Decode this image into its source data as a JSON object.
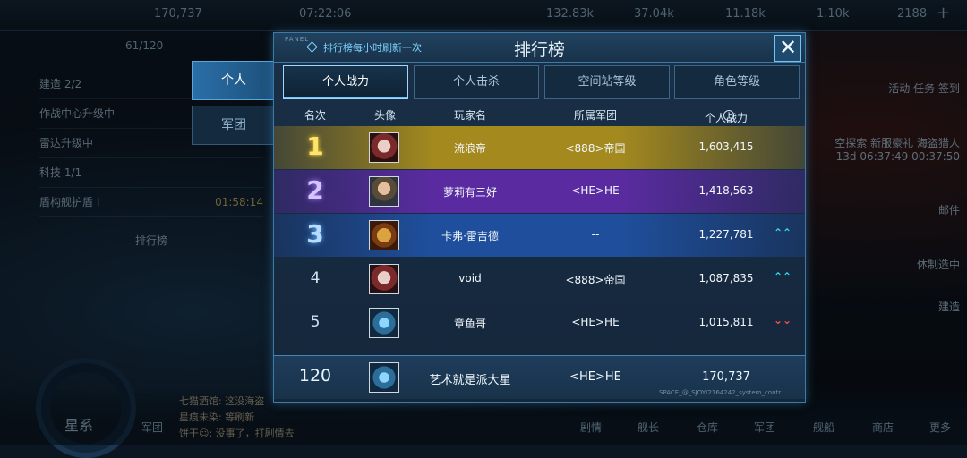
{
  "hud": {
    "top_values": [
      "170,737",
      "07:22:06",
      "132.83k",
      "37.04k",
      "11.18k",
      "1.10k",
      "2188"
    ],
    "level": "61/120",
    "left_rows": [
      "建造 2/2",
      "作战中心升级中",
      "雷达升级中",
      "科技 1/1",
      "盾构舰护盾 I",
      "排行榜"
    ],
    "shield_timer": "01:58:14",
    "right_items": [
      "活动",
      "任务",
      "签到",
      "空探索",
      "新服豪礼",
      "海盗猎人",
      "13d 06:37:49",
      "00:37:50",
      "邮件",
      "体制造中",
      "建造"
    ],
    "galaxy_label": "星系",
    "chat_lines": [
      "七猫酒馆: 这没海盗",
      "星痕未染: 等刷新",
      "饼干☺: 没事了，打剧情去"
    ],
    "nav_items": [
      "军团",
      "剧情",
      "舰长",
      "仓库",
      "军团",
      "舰船",
      "商店",
      "更多"
    ]
  },
  "side_tabs": {
    "personal": "个人",
    "legion": "军团"
  },
  "panel": {
    "tag": "PANEL",
    "title": "排行榜",
    "refresh_note": "排行榜每小时刷新一次",
    "close_symbol": "✕",
    "tabs": [
      "个人战力",
      "个人击杀",
      "空间站等级",
      "角色等级"
    ],
    "active_tab": "个人战力",
    "columns": [
      "名次",
      "头像",
      "玩家名",
      "所属军团",
      "个人战力"
    ],
    "info_symbol": "i",
    "rows": [
      {
        "rank": "1",
        "name": "流浪帝",
        "legion": "<888>帝国",
        "power": "1,603,415",
        "trend": ""
      },
      {
        "rank": "2",
        "name": "萝莉有三好",
        "legion": "<HE>HE",
        "power": "1,418,563",
        "trend": ""
      },
      {
        "rank": "3",
        "name": "卡弗·雷吉德",
        "legion": "--",
        "power": "1,227,781",
        "trend": "up"
      },
      {
        "rank": "4",
        "name": "void",
        "legion": "<888>帝国",
        "power": "1,087,835",
        "trend": "up"
      },
      {
        "rank": "5",
        "name": "章鱼哥",
        "legion": "<HE>HE",
        "power": "1,015,811",
        "trend": "down"
      }
    ],
    "self_row": {
      "rank": "120",
      "name": "艺术就是派大星",
      "legion": "<HE>HE",
      "power": "170,737"
    },
    "watermark": "SPACE_@_SJOY/2164242_system_contr",
    "trend_up_symbol": "⌃⌃",
    "trend_down_symbol": "⌄⌄"
  },
  "colors": {
    "gold": "#a3891e",
    "purple": "#5a2ba0",
    "blue": "#1f4f9c",
    "accent": "#6fc6f5"
  }
}
